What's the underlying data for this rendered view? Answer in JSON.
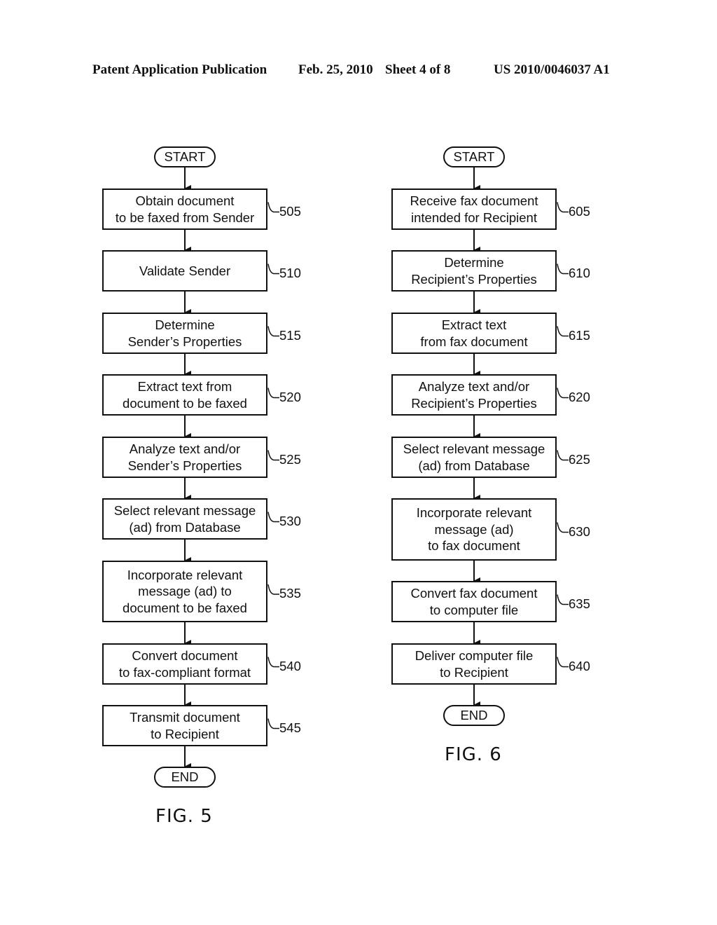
{
  "header": {
    "publication": "Patent Application Publication",
    "date": "Feb. 25, 2010",
    "sheet": "Sheet 4 of 8",
    "number": "US 2010/0046037 A1"
  },
  "fig5": {
    "caption": "FIG. 5",
    "start": "START",
    "end": "END",
    "steps": [
      {
        "text": "Obtain document\nto be faxed from Sender",
        "ref": "505"
      },
      {
        "text": "Validate Sender",
        "ref": "510"
      },
      {
        "text": "Determine\nSender’s Properties",
        "ref": "515"
      },
      {
        "text": "Extract text from\ndocument to be faxed",
        "ref": "520"
      },
      {
        "text": "Analyze text and/or\nSender’s Properties",
        "ref": "525"
      },
      {
        "text": "Select relevant message\n(ad) from Database",
        "ref": "530"
      },
      {
        "text": "Incorporate relevant\nmessage (ad) to\ndocument to be faxed",
        "ref": "535"
      },
      {
        "text": "Convert document\nto fax-compliant format",
        "ref": "540"
      },
      {
        "text": "Transmit document\nto Recipient",
        "ref": "545"
      }
    ]
  },
  "fig6": {
    "caption": "FIG. 6",
    "start": "START",
    "end": "END",
    "steps": [
      {
        "text": "Receive fax document\nintended for Recipient",
        "ref": "605"
      },
      {
        "text": "Determine\nRecipient’s Properties",
        "ref": "610"
      },
      {
        "text": "Extract text\nfrom fax document",
        "ref": "615"
      },
      {
        "text": "Analyze text and/or\nRecipient’s Properties",
        "ref": "620"
      },
      {
        "text": "Select relevant message\n(ad) from Database",
        "ref": "625"
      },
      {
        "text": "Incorporate relevant\nmessage (ad)\nto fax document",
        "ref": "630"
      },
      {
        "text": "Convert fax document\nto computer file",
        "ref": "635"
      },
      {
        "text": "Deliver computer file\nto Recipient",
        "ref": "640"
      }
    ]
  }
}
